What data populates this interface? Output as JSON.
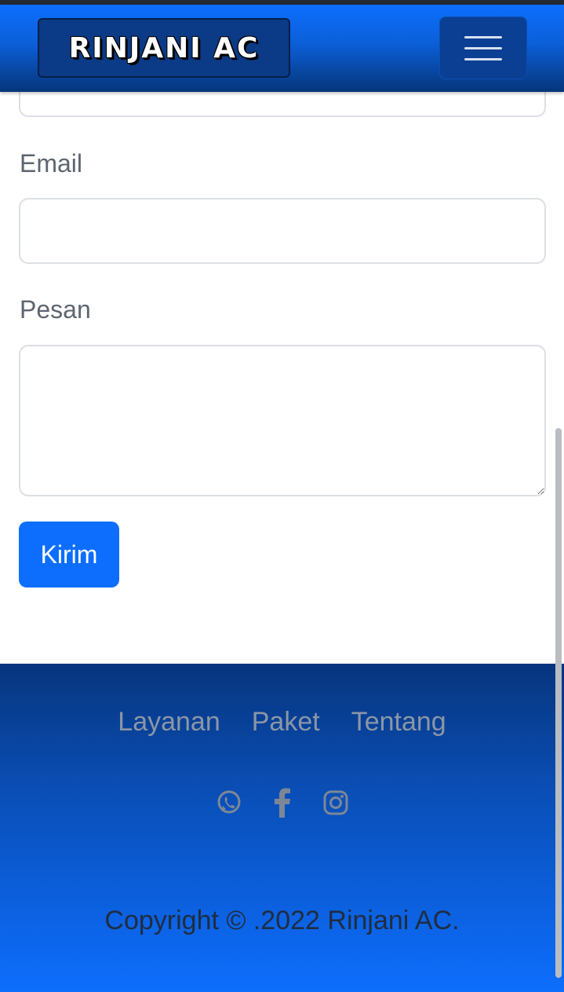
{
  "navbar": {
    "brand": "RINJANI AC",
    "toggler_icon": "hamburger-menu-icon"
  },
  "form": {
    "email_label": "Email",
    "email_value": "",
    "pesan_label": "Pesan",
    "pesan_value": "",
    "submit_label": "Kirim"
  },
  "footer": {
    "links": [
      "Layanan",
      "Paket",
      "Tentang"
    ],
    "social_icons": [
      "whatsapp-icon",
      "facebook-icon",
      "instagram-icon"
    ],
    "copyright": "Copyright © .2022 Rinjani AC."
  },
  "colors": {
    "primary": "#0d6efd",
    "footer_dark": "#07357d",
    "link_gray": "#8b96a6"
  }
}
